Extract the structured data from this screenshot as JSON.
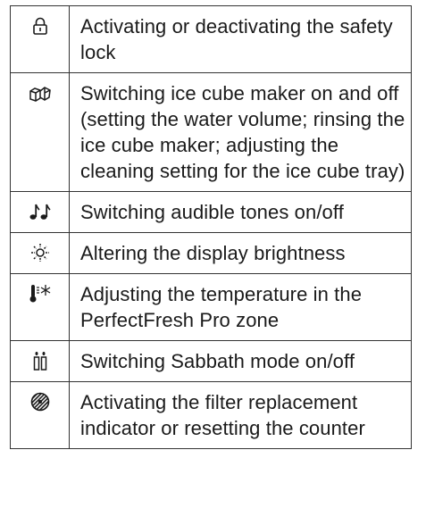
{
  "rows": [
    {
      "icon": "padlock-icon",
      "text": "Activating or deactivating the safety lock"
    },
    {
      "icon": "ice-cubes-icon",
      "text": "Switching ice cube maker on and off (setting the water volume; rinsing the ice cube maker; adjusting the cleaning setting for the ice cube tray)"
    },
    {
      "icon": "music-notes-icon",
      "text": "Switching audible tones on/off"
    },
    {
      "icon": "sun-brightness-icon",
      "text": "Altering the display brightness"
    },
    {
      "icon": "thermometer-snowflake-icon",
      "text": "Adjusting the temperature in the PerfectFresh Pro zone"
    },
    {
      "icon": "candles-icon",
      "text": "Switching Sabbath mode on/off"
    },
    {
      "icon": "filter-icon",
      "text": "Activating the filter replacement indicator or resetting the counter"
    }
  ]
}
